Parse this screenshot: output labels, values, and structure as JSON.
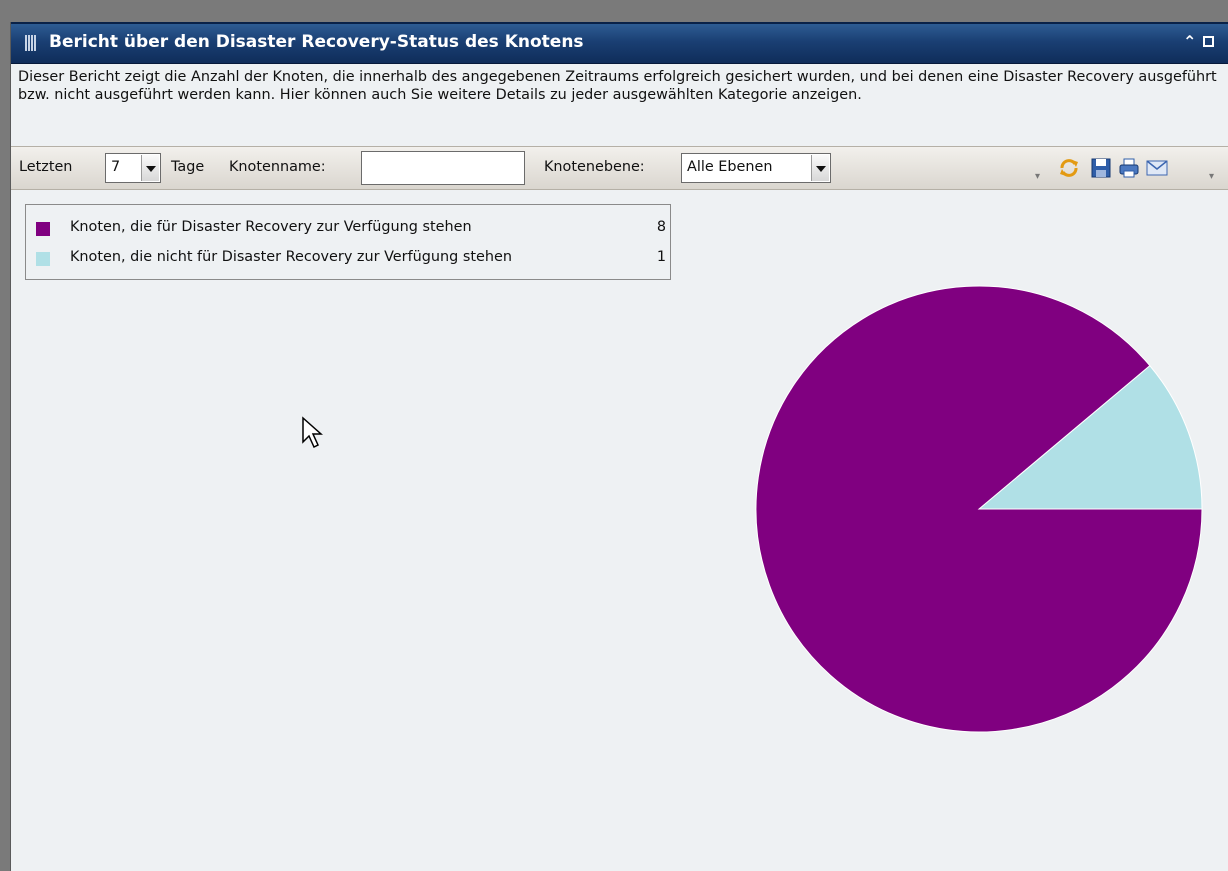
{
  "window": {
    "title": "Bericht über den Disaster Recovery-Status des Knotens",
    "collapse_icon": "double-chevron-up-icon",
    "maximize_icon": "maximize-icon"
  },
  "description": "Dieser Bericht zeigt die Anzahl der Knoten, die innerhalb des angegebenen Zeitraums erfolgreich gesichert wurden, und bei denen eine Disaster Recovery ausgeführt bzw. nicht ausgeführt werden kann. Hier können auch Sie weitere Details zu jeder ausgewählten Kategorie anzeigen.",
  "toolbar": {
    "last_label": "Letzten",
    "days_value": "7",
    "days_label": "Tage",
    "node_name_label": "Knotenname:",
    "node_name_value": "",
    "node_level_label": "Knotenebene:",
    "node_level_value": "Alle Ebenen",
    "icons": [
      "refresh-icon",
      "save-icon",
      "print-icon",
      "email-icon"
    ]
  },
  "colors": {
    "available": "#800080",
    "not_available": "#b0e0e6"
  },
  "chart_data": {
    "type": "pie",
    "title": "",
    "slices": [
      {
        "label": "Knoten, die für Disaster Recovery zur Verfügung stehen",
        "value": 8,
        "color": "#800080"
      },
      {
        "label": "Knoten, die nicht für Disaster Recovery zur Verfügung stehen",
        "value": 1,
        "color": "#b0e0e6"
      }
    ],
    "legend_position": "top-left"
  }
}
